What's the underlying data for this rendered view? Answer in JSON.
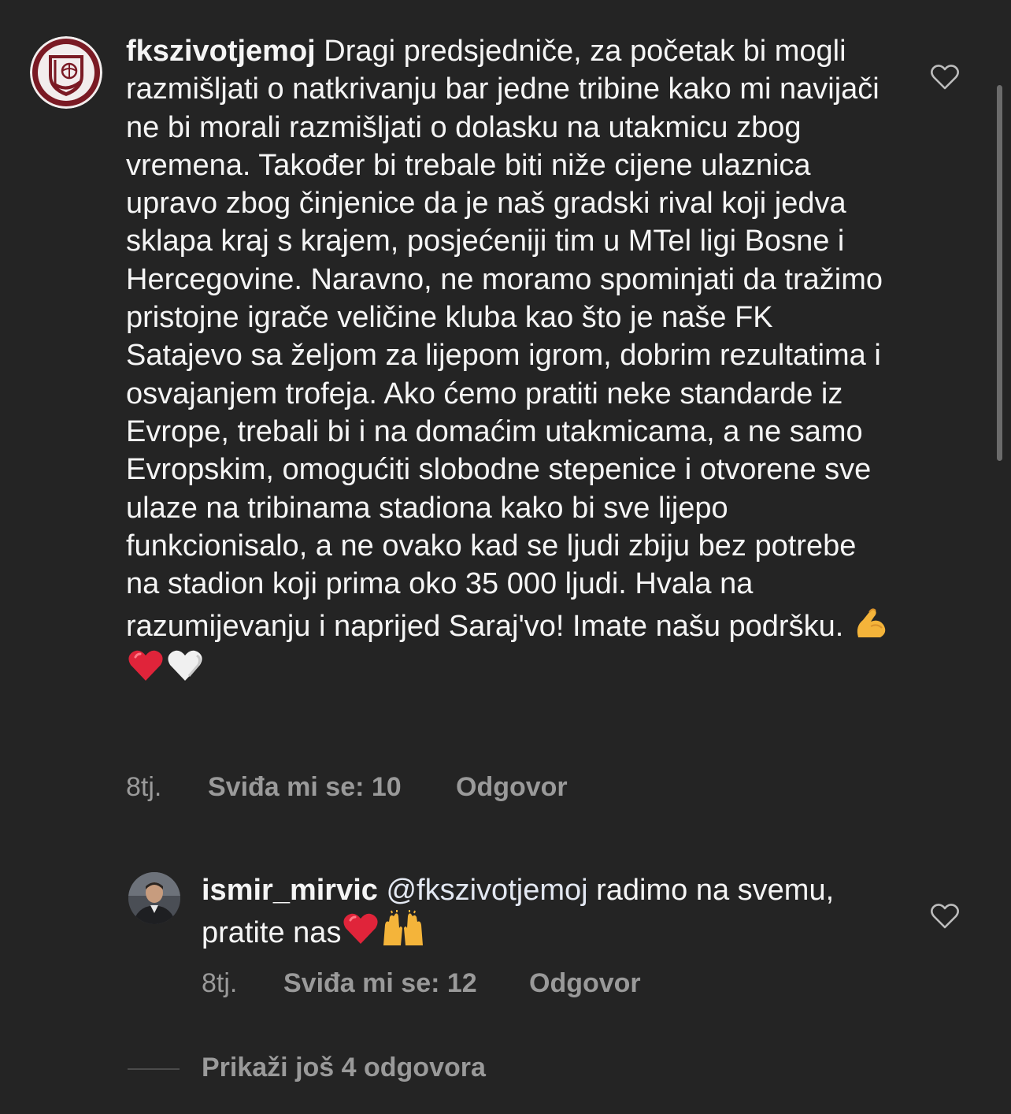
{
  "comment1": {
    "username": "fkszivotjemoj",
    "text": "Dragi predsjedniče, za početak bi mogli razmišljati o natkrivanju bar jedne tribine kako mi navijači ne bi morali razmišljati o dolasku na utakmicu zbog vremena. Također bi trebale biti niže cijene ulaznica upravo zbog činjenice da je naš gradski rival koji jedva sklapa kraj s krajem, posjećeniji tim u MTel ligi Bosne i Hercegovine. Naravno, ne moramo spominjati da tražimo pristojne igrače veličine kluba kao što je naše FK Satajevo sa željom za lijepom igrom, dobrim rezultatima i osvajanjem trofeja. Ako ćemo pratiti neke standarde iz Evrope, trebali bi i na domaćim utakmicama, a ne samo Evropskim, omogućiti slobodne stepenice i otvorene sve ulaze na tribinama stadiona kako bi sve lijepo funkcionisalo, a ne ovako kad se ljudi zbiju bez potrebe na stadion koji prima oko 35 000 ljudi. Hvala na razumijevanju i naprijed Saraj'vo! Imate našu podršku.",
    "emojis": [
      "flexed-biceps",
      "red-heart",
      "white-heart"
    ],
    "time": "8tj.",
    "likes": "Sviđa mi se: 10",
    "reply": "Odgovor"
  },
  "comment2": {
    "username": "ismir_mirvic",
    "mention": "@fkszivotjemoj",
    "text": "radimo na svemu, pratite nas",
    "emojis": [
      "red-heart",
      "raising-hands"
    ],
    "time": "8tj.",
    "likes": "Sviđa mi se: 12",
    "reply": "Odgovor"
  },
  "view_more": "Prikaži još 4 odgovora",
  "colors": {
    "background": "#242424",
    "text": "#f5f5f5",
    "muted": "#9a9a9a",
    "heart_red": "#e0243a"
  }
}
